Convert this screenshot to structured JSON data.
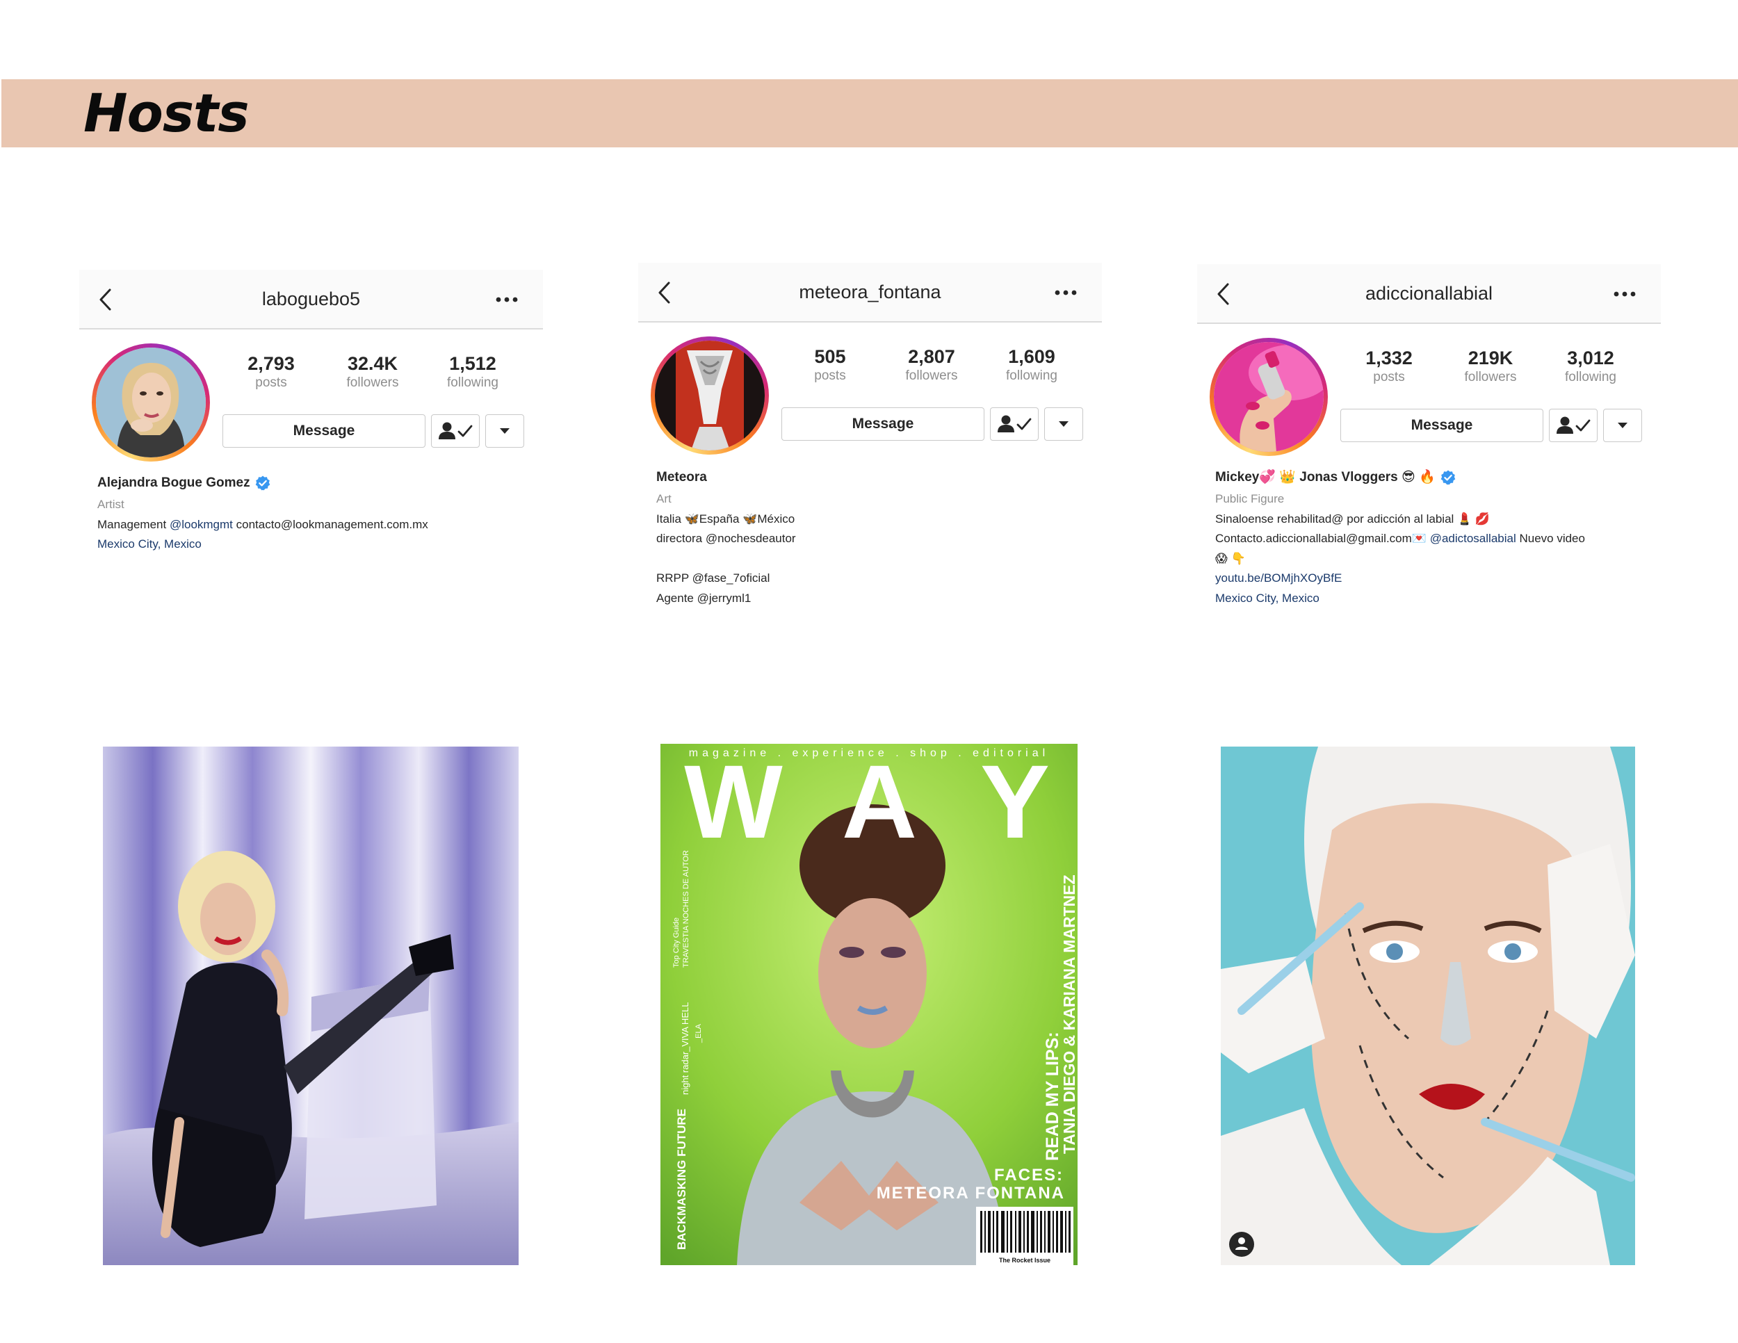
{
  "page": {
    "title": "Hosts"
  },
  "profiles": [
    {
      "username": "laboguebo5",
      "stats": {
        "posts": "2,793",
        "posts_label": "posts",
        "followers": "32.4K",
        "followers_label": "followers",
        "following": "1,512",
        "following_label": "following"
      },
      "message_label": "Message",
      "name": "Alejandra Bogue Gomez",
      "verified": true,
      "category": "Artist",
      "bio": {
        "l1_prefix": "Management ",
        "l1_mention": "@lookmgmt",
        "l1_suffix": " contacto@lookmanagement.com.mx",
        "location": "Mexico City, Mexico"
      }
    },
    {
      "username": "meteora_fontana",
      "stats": {
        "posts": "505",
        "posts_label": "posts",
        "followers": "2,807",
        "followers_label": "followers",
        "following": "1,609",
        "following_label": "following"
      },
      "message_label": "Message",
      "name": "Meteora",
      "verified": false,
      "category": "Art",
      "bio": {
        "l1": "Italia 🦋España 🦋México",
        "l2": "directora @nochesdeautor",
        "l3": "RRPP @fase_7oficial",
        "l4": "Agente @jerryml1"
      }
    },
    {
      "username": "adiccionallabial",
      "stats": {
        "posts": "1,332",
        "posts_label": "posts",
        "followers": "219K",
        "followers_label": "followers",
        "following": "3,012",
        "following_label": "following"
      },
      "message_label": "Message",
      "name": "Mickey💞 👑 Jonas Vloggers 😎 🔥",
      "verified": true,
      "category": "Public Figure",
      "bio": {
        "l1": "Sinaloense rehabilitad@ por adicción al labial 💄 💋",
        "l2_prefix": "Contacto.adiccionallabial@gmail.com💌 ",
        "l2_mention": "@adictosallabial",
        "l2_suffix": " Nuevo video",
        "l3": "😱 👇",
        "link": "youtu.be/BOMjhXOyBfE",
        "location": "Mexico City, Mexico"
      }
    }
  ],
  "cover": {
    "topline": "magazine . experience . shop . editorial",
    "logo_w": "W",
    "logo_a": "A",
    "logo_y": "Y",
    "side_right": "READ MY LIPS:",
    "side_right2": "TANIA DIEGO & KARIANA MARTNEZ",
    "faces": "FACES:",
    "faces_name": "METEORA FONTANA",
    "side_left1": "Top City Guide",
    "side_left2": "TRAVESTIA NOCHES DE AUTOR",
    "side_left3": "night radar_VIVA HELL",
    "side_left4": "_ELA",
    "side_left5": "BACKMASKING FUTURE",
    "issue": "The Rocket Issue"
  },
  "colors": {
    "banner": "#e9c6b1",
    "verified": "#3897f0",
    "link": "#1b3a6b",
    "muted": "#8e8e8e",
    "cover_green": "#8fcf3a"
  }
}
